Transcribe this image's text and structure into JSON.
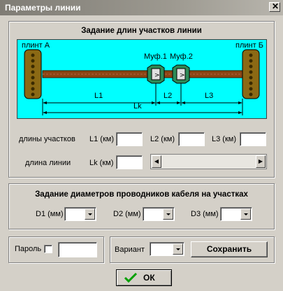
{
  "window": {
    "title": "Параметры линии"
  },
  "lengths_section": {
    "title": "Задание длин участков линии",
    "diagram": {
      "left_label": "плинт А",
      "right_label": "плинт Б",
      "coupling1": "Муф.1",
      "coupling2": "Муф.2",
      "dim_l1": "L1",
      "dim_l2": "L2",
      "dim_l3": "L3",
      "dim_lk": "Lk"
    },
    "segments_label": "длины участков",
    "l1_label": "L1 (км)",
    "l2_label": "L2 (км)",
    "l3_label": "L3 (км)",
    "line_length_label": "длина линии",
    "lk_label": "Lk (км)",
    "l1_value": "",
    "l2_value": "",
    "l3_value": "",
    "lk_value": ""
  },
  "diameters_section": {
    "title": "Задание диаметров проводников кабеля на участках",
    "d1_label": "D1 (мм)",
    "d2_label": "D2 (мм)",
    "d3_label": "D3 (мм)",
    "d1_value": "",
    "d2_value": "",
    "d3_value": ""
  },
  "password": {
    "label": "Пароль",
    "value": ""
  },
  "variant": {
    "label": "Вариант",
    "value": ""
  },
  "buttons": {
    "save": "Сохранить",
    "ok": "ОК"
  },
  "colors": {
    "diagram_bg": "#00ffff",
    "cable": "#8b4513",
    "ok_check": "#00a000"
  }
}
